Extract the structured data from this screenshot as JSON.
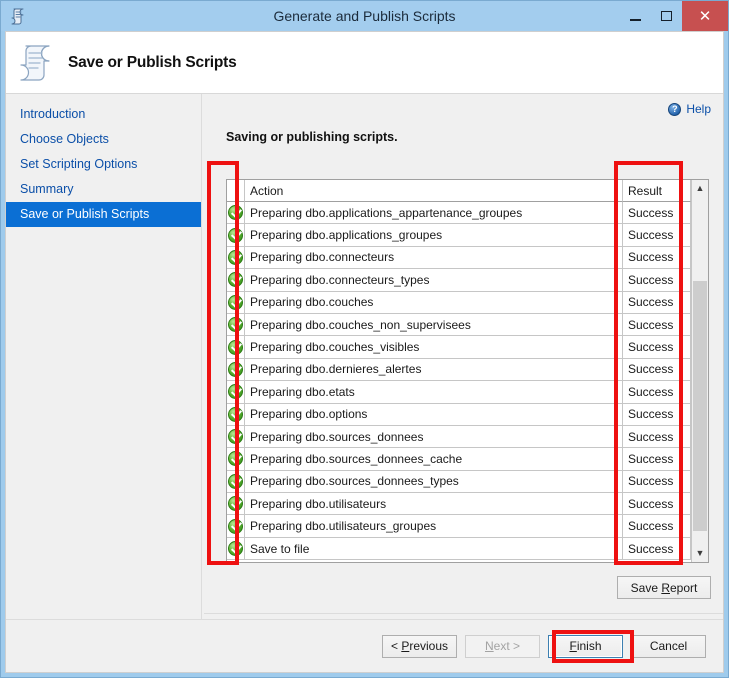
{
  "window": {
    "title": "Generate and Publish Scripts",
    "icon": "script-scroll-icon",
    "controls": {
      "minimize": "minimize-icon",
      "maximize": "maximize-icon",
      "close": "close-icon",
      "close_glyph": "✕"
    }
  },
  "banner": {
    "title": "Save or Publish Scripts",
    "icon": "script-scroll-icon"
  },
  "sidebar": {
    "items": [
      {
        "label": "Introduction",
        "active": false
      },
      {
        "label": "Choose Objects",
        "active": false
      },
      {
        "label": "Set Scripting Options",
        "active": false
      },
      {
        "label": "Summary",
        "active": false
      },
      {
        "label": "Save or Publish Scripts",
        "active": true
      }
    ]
  },
  "help": {
    "label": "Help",
    "icon": "help-circle-icon",
    "glyph": "?"
  },
  "content": {
    "subtitle": "Saving or publishing scripts."
  },
  "grid": {
    "columns": [
      "",
      "Action",
      "Result"
    ],
    "rows": [
      {
        "status": "success",
        "action": "Preparing dbo.applications_appartenance_groupes",
        "result": "Success"
      },
      {
        "status": "success",
        "action": "Preparing dbo.applications_groupes",
        "result": "Success"
      },
      {
        "status": "success",
        "action": "Preparing dbo.connecteurs",
        "result": "Success"
      },
      {
        "status": "success",
        "action": "Preparing dbo.connecteurs_types",
        "result": "Success"
      },
      {
        "status": "success",
        "action": "Preparing dbo.couches",
        "result": "Success"
      },
      {
        "status": "success",
        "action": "Preparing dbo.couches_non_supervisees",
        "result": "Success"
      },
      {
        "status": "success",
        "action": "Preparing dbo.couches_visibles",
        "result": "Success"
      },
      {
        "status": "success",
        "action": "Preparing dbo.dernieres_alertes",
        "result": "Success"
      },
      {
        "status": "success",
        "action": "Preparing dbo.etats",
        "result": "Success"
      },
      {
        "status": "success",
        "action": "Preparing dbo.options",
        "result": "Success"
      },
      {
        "status": "success",
        "action": "Preparing dbo.sources_donnees",
        "result": "Success"
      },
      {
        "status": "success",
        "action": "Preparing dbo.sources_donnees_cache",
        "result": "Success"
      },
      {
        "status": "success",
        "action": "Preparing dbo.sources_donnees_types",
        "result": "Success"
      },
      {
        "status": "success",
        "action": "Preparing dbo.utilisateurs",
        "result": "Success"
      },
      {
        "status": "success",
        "action": "Preparing dbo.utilisateurs_groupes",
        "result": "Success"
      },
      {
        "status": "success",
        "action": "Save to file",
        "result": "Success"
      }
    ],
    "scrollbar": {
      "up_arrow": "chevron-up-icon",
      "down_arrow": "chevron-down-icon"
    }
  },
  "buttons": {
    "save_report": "Save Report",
    "save_report_accel": "R",
    "previous": "< Previous",
    "previous_accel": "P",
    "next": "Next >",
    "next_accel": "N",
    "next_disabled": true,
    "finish": "Finish",
    "finish_accel": "F",
    "finish_focused": true,
    "cancel": "Cancel"
  },
  "annotations": {
    "highlight_color": "#ee1111",
    "regions": [
      "status-icon-column",
      "result-column",
      "finish-button"
    ]
  }
}
